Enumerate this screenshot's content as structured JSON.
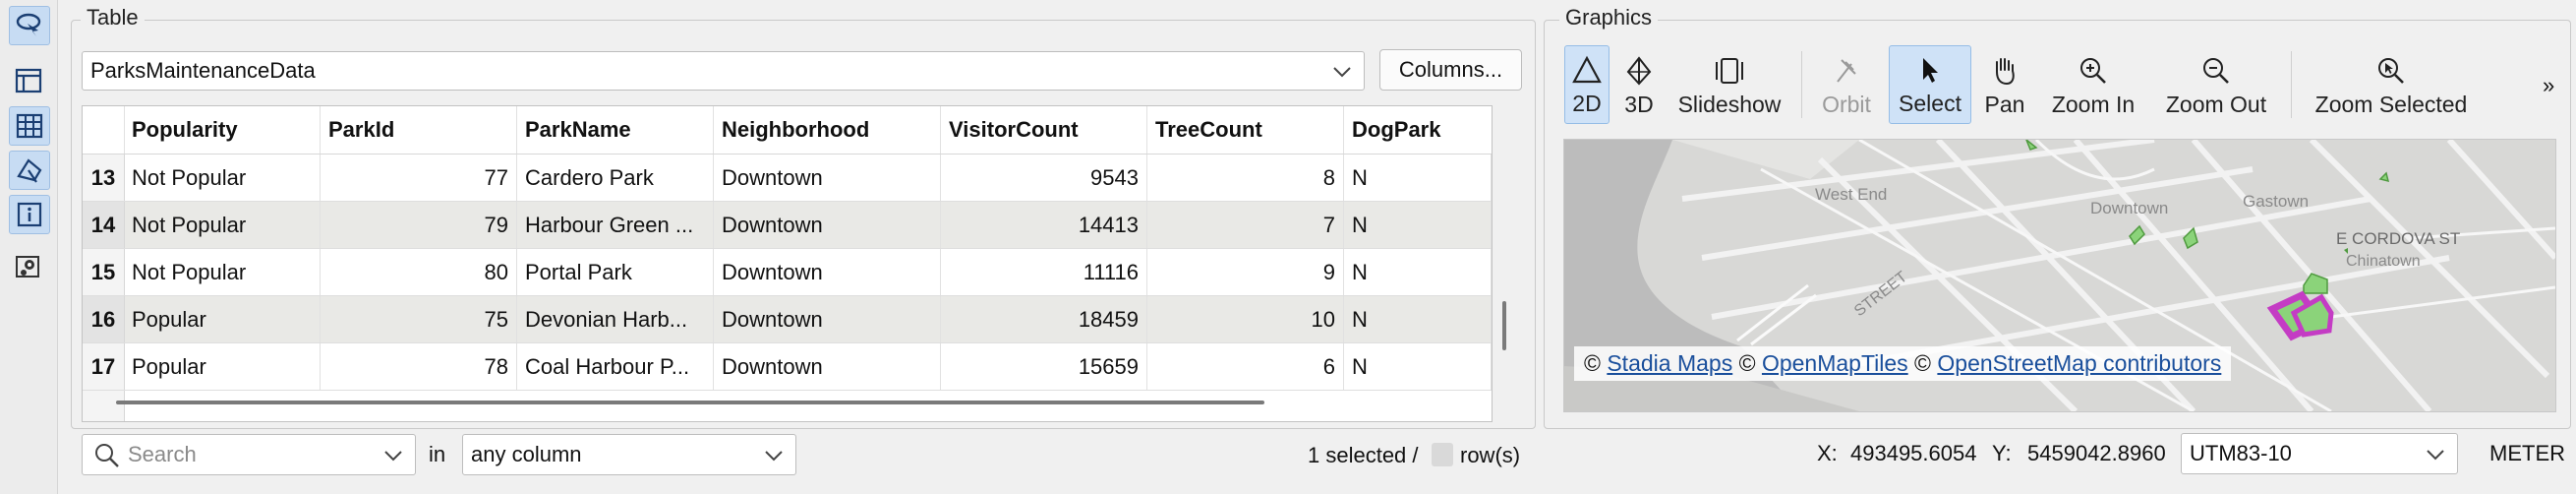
{
  "left_toolbar": {
    "items": [
      "lasso-select-icon",
      "layout-icon",
      "table-icon",
      "select-tools-icon",
      "info-icon",
      "map-pin-icon"
    ]
  },
  "table_panel": {
    "title": "Table",
    "dataset": "ParksMaintenanceData",
    "columns_button": "Columns...",
    "headers": [
      "Popularity",
      "ParkId",
      "ParkName",
      "Neighborhood",
      "VisitorCount",
      "TreeCount",
      "DogPark"
    ],
    "rows": [
      {
        "n": "13",
        "cells": [
          "Not Popular",
          "77",
          "Cardero Park",
          "Downtown",
          "9543",
          "8",
          "N"
        ]
      },
      {
        "n": "14",
        "cells": [
          "Not Popular",
          "79",
          "Harbour Green ...",
          "Downtown",
          "14413",
          "7",
          "N"
        ]
      },
      {
        "n": "15",
        "cells": [
          "Not Popular",
          "80",
          "Portal Park",
          "Downtown",
          "11116",
          "9",
          "N"
        ]
      },
      {
        "n": "16",
        "cells": [
          "Popular",
          "75",
          "Devonian Harb...",
          "Downtown",
          "18459",
          "10",
          "N"
        ]
      },
      {
        "n": "17",
        "cells": [
          "Popular",
          "78",
          "Coal Harbour P...",
          "Downtown",
          "15659",
          "6",
          "N"
        ]
      }
    ],
    "search_placeholder": "Search",
    "in_label": "in",
    "column_filter": "any column",
    "selection_status": "1 selected /",
    "rows_suffix": "row(s)"
  },
  "graphics_panel": {
    "title": "Graphics",
    "tools": [
      {
        "label": "2D",
        "icon": "2d-icon"
      },
      {
        "label": "3D",
        "icon": "3d-icon"
      },
      {
        "label": "Slideshow",
        "icon": "slideshow-icon"
      },
      {
        "label": "Orbit",
        "icon": "orbit-icon"
      },
      {
        "label": "Select",
        "icon": "select-arrow-icon"
      },
      {
        "label": "Pan",
        "icon": "pan-hand-icon"
      },
      {
        "label": "Zoom In",
        "icon": "zoom-in-icon"
      },
      {
        "label": "Zoom Out",
        "icon": "zoom-out-icon"
      },
      {
        "label": "Zoom Selected",
        "icon": "zoom-selected-icon"
      }
    ],
    "overflow": "»",
    "map_labels": {
      "west_end": "West End",
      "downtown": "Downtown",
      "gastown": "Gastown",
      "cordova": "E CORDOVA ST",
      "chinatown": "Chinatown",
      "street": "STREET"
    },
    "attribution": {
      "c1": "©",
      "link1": "Stadia Maps",
      "c2": "©",
      "link2": "OpenMapTiles",
      "c3": "©",
      "link3": "OpenStreetMap contributors"
    },
    "status": {
      "x_label": "X:",
      "x_value": "493495.6054",
      "y_label": "Y:",
      "y_value": "5459042.8960",
      "crs": "UTM83-10",
      "units": "METER"
    }
  },
  "colors": {
    "selection": "#cfe2f7",
    "selected_feature": "#c43cc4",
    "park_fill": "#8bd37a",
    "link": "#1a4f9c"
  }
}
